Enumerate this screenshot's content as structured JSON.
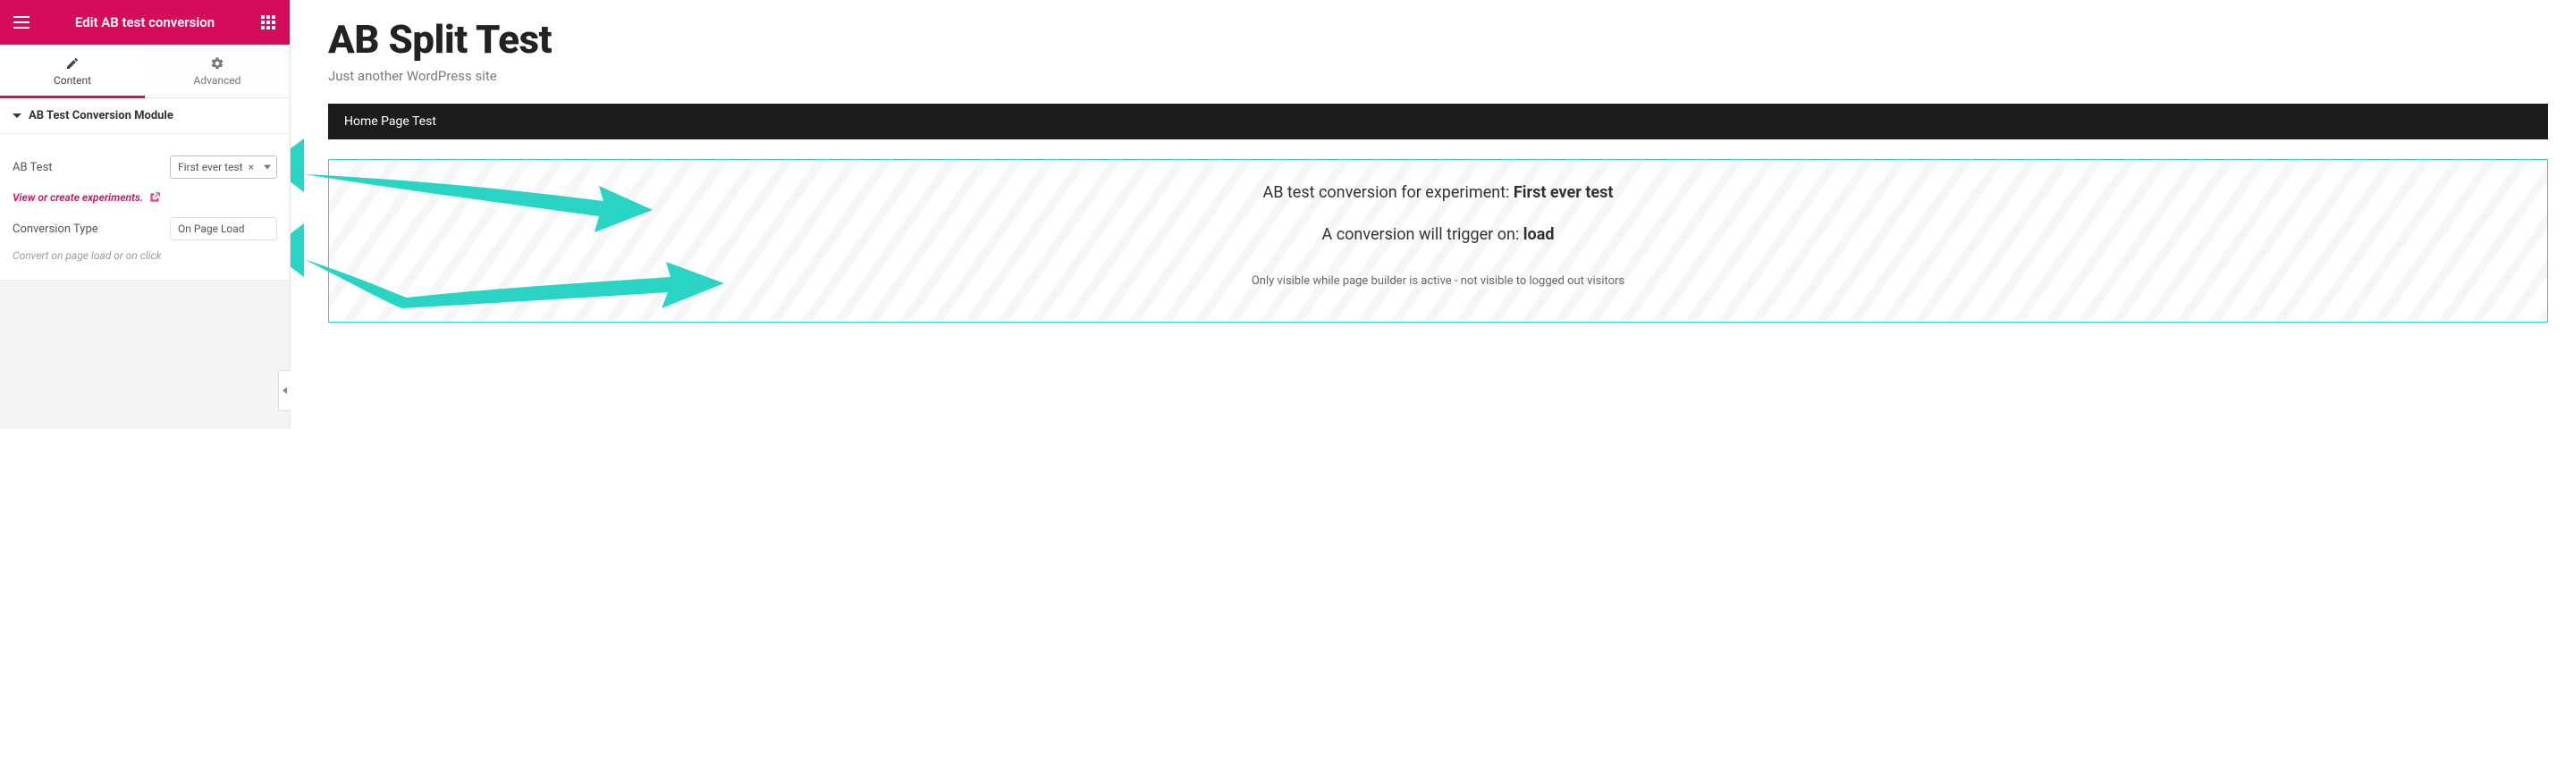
{
  "sidebar": {
    "title": "Edit AB test conversion",
    "tabs": {
      "content": "Content",
      "advanced": "Advanced"
    },
    "section_title": "AB Test Conversion Module",
    "field_ab_test_label": "AB Test",
    "field_ab_test_value": "First ever test",
    "view_experiments_link": "View or create experiments.",
    "field_conv_type_label": "Conversion Type",
    "field_conv_type_value": "On Page Load",
    "conv_type_help": "Convert on page load or on click"
  },
  "preview": {
    "site_title": "AB Split Test",
    "site_tagline": "Just another WordPress site",
    "nav_item": "Home Page Test",
    "conv_line1_pre": "AB test conversion for experiment: ",
    "conv_line1_bold": "First ever test",
    "conv_line2_pre": "A conversion will trigger on: ",
    "conv_line2_bold": "load",
    "conv_note": "Only visible while page builder is active - not visible to logged out visitors"
  }
}
